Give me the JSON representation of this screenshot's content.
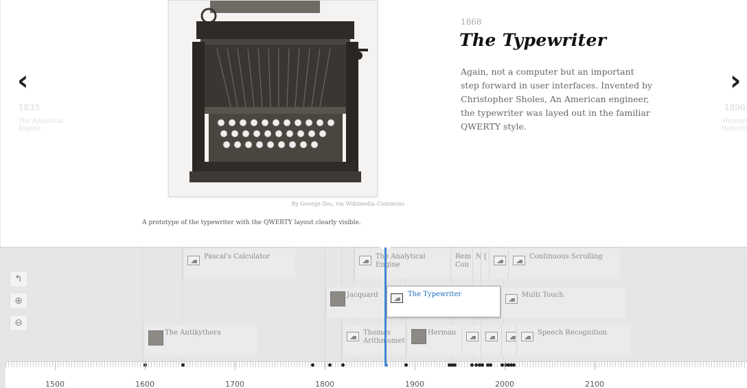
{
  "slider": {
    "prev": {
      "year": "1833",
      "title": "The Analytical Engine"
    },
    "next": {
      "year": "1890",
      "title": "Herman Hollerith"
    },
    "current": {
      "year": "1868",
      "title": "The Typewriter",
      "text": "Again, not a computer but an important step forward in user interfaces. Invented by Christopher Sholes, An American engineer, the typewriter was layed out in the familiar QWERTY style.",
      "media_credit": "By George Iles, via Wikimedia Commons",
      "media_caption": "A prototype of the typewriter with the QWERTY layout clearly visible."
    }
  },
  "navigator": {
    "markers": [
      {
        "id": "pascal",
        "label": "Pascal's Calculator",
        "thumb": "image-icon"
      },
      {
        "id": "analytical",
        "label": "The Analytical Engine",
        "thumb": "image-icon"
      },
      {
        "id": "rem",
        "label": "Rem Con",
        "thumb": "none"
      },
      {
        "id": "n",
        "label": "N",
        "thumb": "none"
      },
      {
        "id": "bracket",
        "label": "[",
        "thumb": "none"
      },
      {
        "id": "img-a",
        "label": "",
        "thumb": "image-icon"
      },
      {
        "id": "continuous",
        "label": "Continuous Scrolling",
        "thumb": "image-icon"
      },
      {
        "id": "jacquard",
        "label": "Jacquard",
        "thumb": "photo"
      },
      {
        "id": "typewriter",
        "label": "The Typewriter",
        "thumb": "image-icon"
      },
      {
        "id": "multitouch",
        "label": "Multi Touch",
        "thumb": "image-icon"
      },
      {
        "id": "antikythera",
        "label": "The Antikythera",
        "thumb": "photo"
      },
      {
        "id": "thomas",
        "label": "Thomas Arithmometer",
        "thumb": "image-icon"
      },
      {
        "id": "herman",
        "label": "Herman",
        "thumb": "photo"
      },
      {
        "id": "speech",
        "label": "Speech Recognition",
        "thumb": "image-icon"
      }
    ],
    "axis": {
      "labels": [
        "1500",
        "1600",
        "1700",
        "1800",
        "1900",
        "2000",
        "2100"
      ],
      "event_years": [
        1600,
        1642,
        1786,
        1805,
        1820,
        1868,
        1890,
        1938,
        1941,
        1944,
        1963,
        1968,
        1972,
        1975,
        1981,
        1984,
        1997,
        2001,
        2004,
        2007,
        2010
      ]
    },
    "tools": {
      "back": "back-icon",
      "zoom_in": "zoom-in-icon",
      "zoom_out": "zoom-out-icon"
    }
  },
  "colors": {
    "accent": "#3e86cf",
    "title": "#111111",
    "body_text": "#666666"
  }
}
